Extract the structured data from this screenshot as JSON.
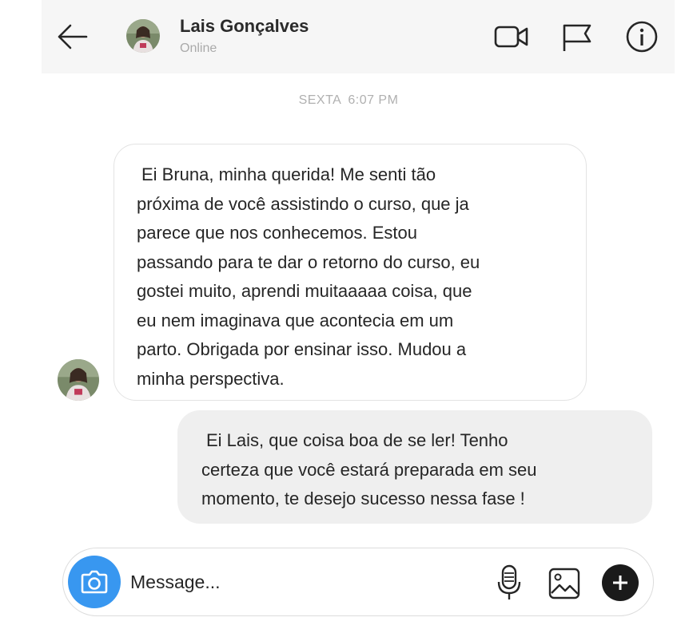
{
  "header": {
    "contact_name": "Lais Gonçalves",
    "status": "Online",
    "icons": [
      "back-arrow-icon",
      "video-camera-icon",
      "flag-icon",
      "info-icon"
    ]
  },
  "conversation": {
    "timestamp_day": "SEXTA",
    "timestamp_time": "6:07 PM",
    "messages": [
      {
        "sender": "contact",
        "lines": [
          "Ei Bruna, minha querida! Me senti tão",
          "próxima de você assistindo o curso, que ja",
          "parece que nos conhecemos. Estou",
          "passando para te dar o retorno do curso, eu",
          "gostei muito, aprendi muitaaaaa coisa, que",
          "eu nem imaginava que acontecia em um",
          "parto. Obrigada por ensinar isso. Mudou a",
          "minha perspectiva."
        ]
      },
      {
        "sender": "me",
        "lines": [
          "Ei Lais, que coisa boa de se ler! Tenho",
          "certeza que você estará preparada em seu",
          "momento, te desejo sucesso nessa fase !"
        ]
      }
    ]
  },
  "composer": {
    "placeholder": "Message...",
    "icons": [
      "camera-icon",
      "microphone-icon",
      "gallery-icon",
      "plus-icon"
    ]
  },
  "colors": {
    "accent": "#3897f0",
    "header_bg": "#f6f6f6",
    "outgoing_bubble": "#efefef",
    "muted_text": "#aaaaaa"
  }
}
